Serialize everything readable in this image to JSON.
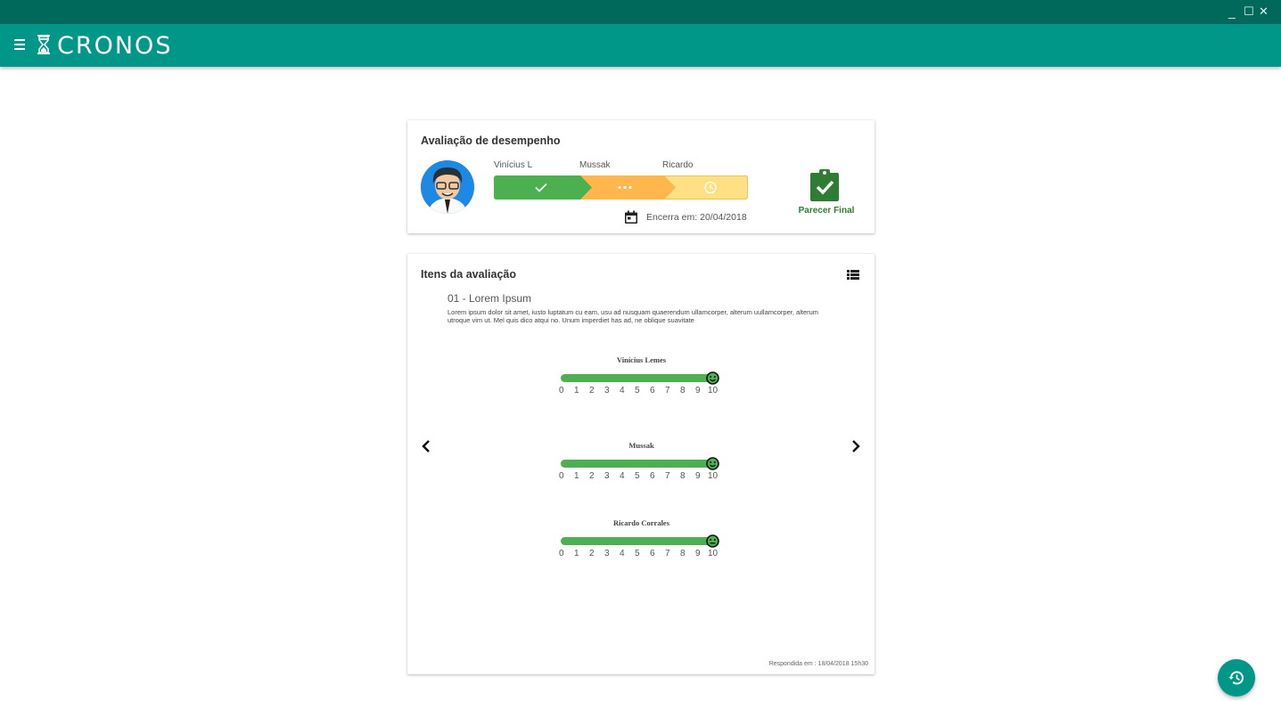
{
  "app": {
    "brand": "CRONOS",
    "colors": {
      "primary": "#009688",
      "primary_dark": "#00695c",
      "success": "#4caf50",
      "warning": "#ffb74d",
      "pending": "#ffe082"
    }
  },
  "window": {
    "minimize": "_",
    "maximize": "☐",
    "close": "✕"
  },
  "summary": {
    "title": "Avaliação de desempenho",
    "steps": [
      {
        "label": "Vinícius L",
        "status": "done",
        "icon": "check-icon"
      },
      {
        "label": "Mussak",
        "status": "in-progress",
        "icon": "dots-icon"
      },
      {
        "label": "Ricardo",
        "status": "pending",
        "icon": "clock-icon"
      }
    ],
    "deadline": "Encerra em: 20/04/2018",
    "final_label": "Parecer Final"
  },
  "items": {
    "title": "Itens da avaliação",
    "item_title": "01 - Lorem Ipsum",
    "item_description": "Lorem ipsum dolor sit amet, iusto luptatum cu eam, usu ad nusquam quaerendum ullamcorper, alterum uullamcorper, alterum utroque vim ut. Mel quis dico atqui no. Unum imperdiet has ad, ne oblique suavitate",
    "scale": [
      "0",
      "1",
      "2",
      "3",
      "4",
      "5",
      "6",
      "7",
      "8",
      "9",
      "10"
    ],
    "raters": [
      {
        "name": "Vinícius Lemes",
        "score": 10,
        "face": "happy-face-icon"
      },
      {
        "name": "Mussak",
        "score": 10,
        "face": "happy-face-icon"
      },
      {
        "name": "Ricardo Corrales",
        "score": 10,
        "face": "neutral-face-icon"
      }
    ],
    "answered": "Respondida em : 18/04/2018 15h30"
  }
}
